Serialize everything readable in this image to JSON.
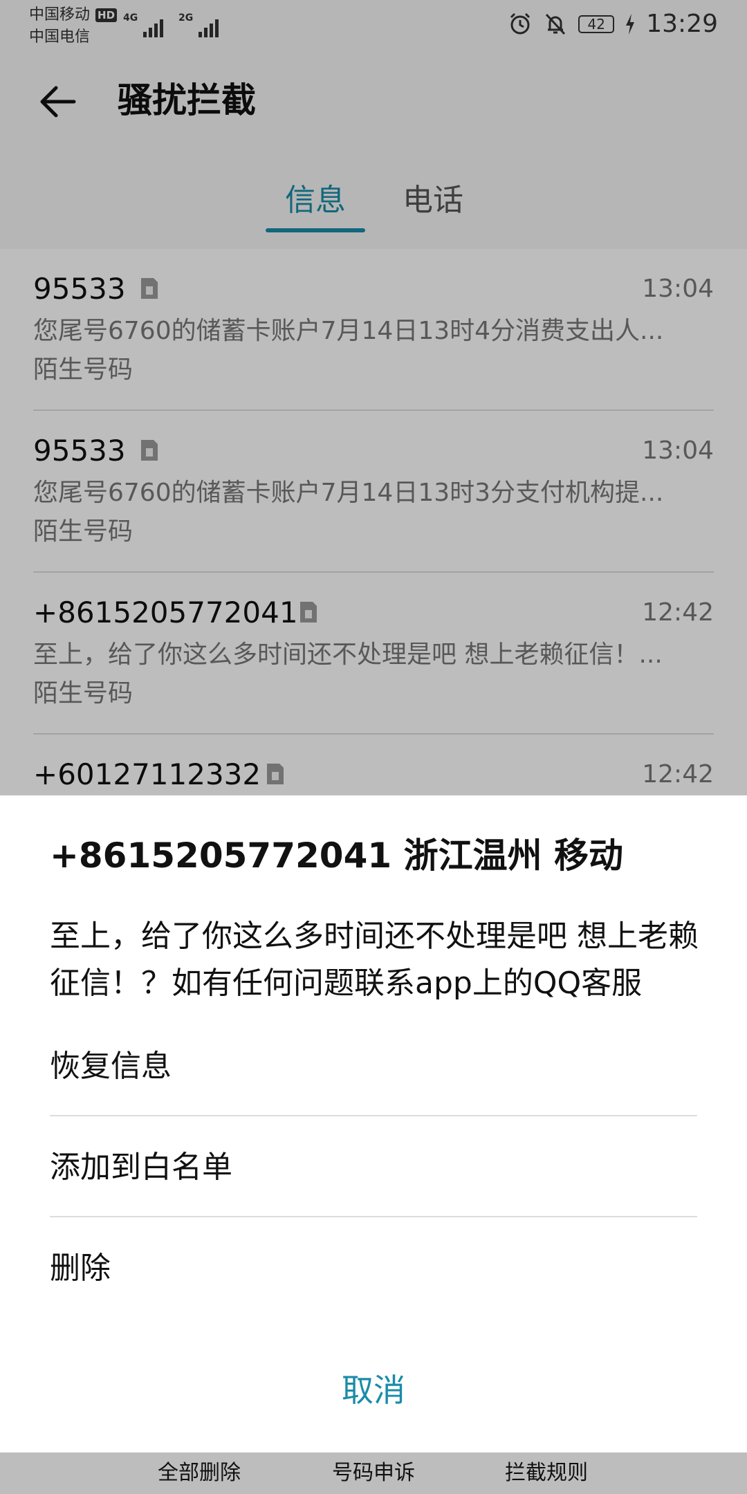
{
  "status_bar": {
    "carrier1": "中国移动",
    "carrier1_badge": "HD",
    "carrier2": "中国电信",
    "network1": "4G",
    "network2": "2G",
    "battery": "42",
    "time": "13:29"
  },
  "header": {
    "title": "骚扰拦截"
  },
  "tabs": [
    {
      "label": "信息",
      "active": true
    },
    {
      "label": "电话",
      "active": false
    }
  ],
  "messages": [
    {
      "number": "95533",
      "time": "13:04",
      "preview": "您尾号6760的储蓄卡账户7月14日13时4分消费支出人...",
      "tag": "陌生号码"
    },
    {
      "number": "95533",
      "time": "13:04",
      "preview": "您尾号6760的储蓄卡账户7月14日13时3分支付机构提...",
      "tag": "陌生号码"
    },
    {
      "number": "+8615205772041",
      "time": "12:42",
      "preview": "至上，给了你这么多时间还不处理是吧 想上老赖征信！...",
      "tag": "陌生号码"
    },
    {
      "number": "+60127112332",
      "time": "12:42",
      "preview": "",
      "tag": ""
    }
  ],
  "sheet": {
    "title": "+8615205772041 浙江温州 移动",
    "body": "至上，给了你这么多时间还不处理是吧 想上老赖征信！？如有任何问题联系app上的QQ客服",
    "items": [
      "恢复信息",
      "添加到白名单",
      "删除"
    ],
    "cancel": "取消"
  },
  "bottom_bar": {
    "delete_all": "全部删除",
    "appeal": "号码申诉",
    "rules": "拦截规则"
  },
  "colors": {
    "accent": "#1a8ca8",
    "overlay": "rgba(0,0,0,0.26)"
  }
}
